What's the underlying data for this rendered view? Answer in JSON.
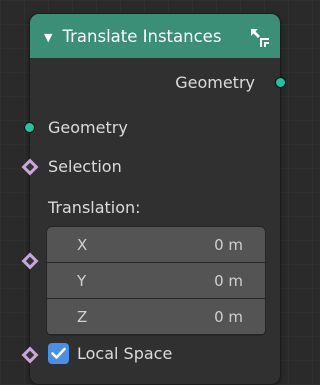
{
  "node": {
    "title": "Translate Instances",
    "header_color": "#3b8f77",
    "collapse_icon": "collapse-arrow-icon",
    "corner_icon": "node-resize-icon"
  },
  "outputs": {
    "geometry": "Geometry"
  },
  "inputs": {
    "geometry": "Geometry",
    "selection": "Selection",
    "translation_label": "Translation:",
    "translation": [
      {
        "axis": "X",
        "value": "0 m"
      },
      {
        "axis": "Y",
        "value": "0 m"
      },
      {
        "axis": "Z",
        "value": "0 m"
      }
    ],
    "local_space": {
      "label": "Local Space",
      "checked": true
    }
  },
  "colors": {
    "geometry_socket": "#21c4a1",
    "field_socket": "#c9a6dc",
    "checkbox": "#4a8fe7"
  }
}
